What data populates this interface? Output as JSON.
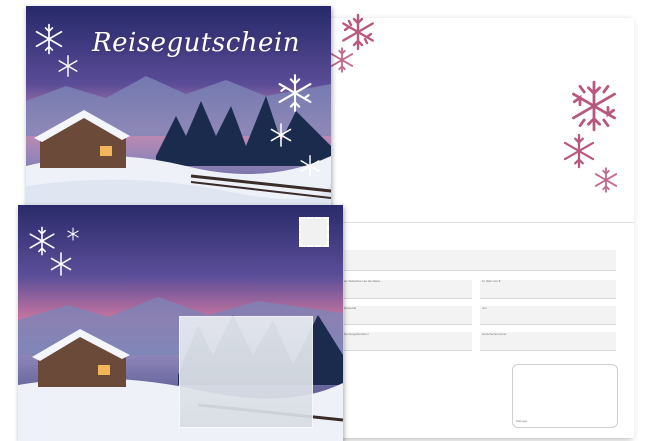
{
  "voucher": {
    "title": "Reisegutschein"
  },
  "form": {
    "labels": {
      "l1": "an Teilnehmer an die Reise",
      "l2": "im Wert von €",
      "l3": "Reiseziel",
      "l4": "von",
      "l5": "bis Ausgabedatum",
      "l6": "Gutscheinnummer",
      "l7": "Stempel"
    }
  },
  "colors": {
    "sky_top": "#2b2a6b",
    "sky_pink": "#c76f9e",
    "snowflake_pink": "#b8587f",
    "snow": "#eef2f8"
  },
  "icons": [
    "snowflake-icon",
    "postage-stamp-icon"
  ]
}
